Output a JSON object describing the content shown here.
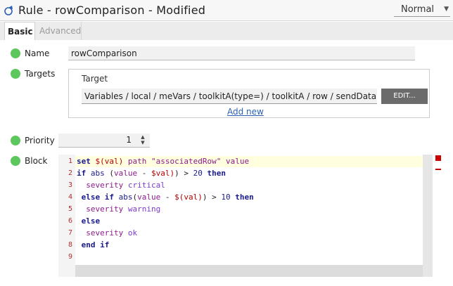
{
  "window": {
    "title": "Rule - rowComparison - Modified",
    "icon": "rule-icon",
    "mode": "Normal"
  },
  "tabs": [
    {
      "label": "Basic",
      "active": true
    },
    {
      "label": "Advanced",
      "active": false
    }
  ],
  "fields": {
    "name": {
      "label": "Name",
      "value": "rowComparison"
    },
    "targets": {
      "label": "Targets",
      "header": "Target",
      "value": "Variables / local / meVars / toolkitA(type=) / toolkitA / row / sendDataRate",
      "edit_label": "EDIT...",
      "add_new_label": "Add new"
    },
    "priority": {
      "label": "Priority",
      "value": "1"
    },
    "block": {
      "label": "Block"
    }
  },
  "colors": {
    "status_dot": "#5cc75c",
    "error_marker": "#cc0000",
    "link": "#2a5fb4"
  },
  "code": {
    "line_numbers": [
      "1",
      "2",
      "3",
      "4",
      "5",
      "6",
      "7",
      "8",
      "9"
    ],
    "lines": [
      "set $(val) path \"associatedRow\" value",
      "if abs (value - $val)) > 20 then",
      "  severity critical",
      " else if abs(value - $(val)) > 10 then",
      "  severity warning",
      " else",
      "  severity ok",
      " end if",
      ""
    ]
  }
}
